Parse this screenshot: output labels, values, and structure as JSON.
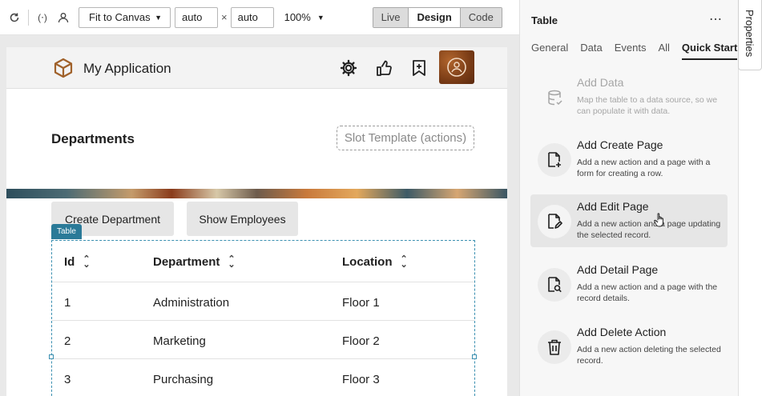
{
  "toolbar": {
    "canvas_fit": "Fit to Canvas",
    "width": "auto",
    "height": "auto",
    "times": "×",
    "zoom": "100%",
    "modes": [
      "Live",
      "Design",
      "Code"
    ],
    "active_mode": "Design"
  },
  "app": {
    "title": "My Application",
    "page_title": "Departments",
    "slot_placeholder": "Slot Template (actions)",
    "buttons": [
      "Create Department",
      "Show Employees"
    ],
    "table_badge": "Table",
    "columns": [
      "Id",
      "Department",
      "Location"
    ],
    "rows": [
      [
        "1",
        "Administration",
        "Floor 1"
      ],
      [
        "2",
        "Marketing",
        "Floor 2"
      ],
      [
        "3",
        "Purchasing",
        "Floor 3"
      ]
    ]
  },
  "panel": {
    "title": "Table",
    "more": "⋯",
    "tabs": [
      "General",
      "Data",
      "Events",
      "All",
      "Quick Start"
    ],
    "active_tab": "Quick Start",
    "quick_start": [
      {
        "title": "Add Data",
        "desc": "Map the table to a data source, so we can populate it with data.",
        "icon": "database-icon",
        "state": "disabled"
      },
      {
        "title": "Add Create Page",
        "desc": "Add a new action and a page with a form for creating a row.",
        "icon": "page-add-icon",
        "state": "normal"
      },
      {
        "title": "Add Edit Page",
        "desc": "Add a new action and a page updating the selected record.",
        "icon": "page-edit-icon",
        "state": "hover"
      },
      {
        "title": "Add Detail Page",
        "desc": "Add a new action and a page with the record details.",
        "icon": "page-search-icon",
        "state": "normal"
      },
      {
        "title": "Add Delete Action",
        "desc": "Add a new action deleting the selected record.",
        "icon": "trash-icon",
        "state": "normal"
      }
    ]
  },
  "side_tab": "Properties",
  "colors": {
    "accent": "#2a7a98",
    "avatar": "#8a4a1e",
    "logo": "#a0612a"
  }
}
